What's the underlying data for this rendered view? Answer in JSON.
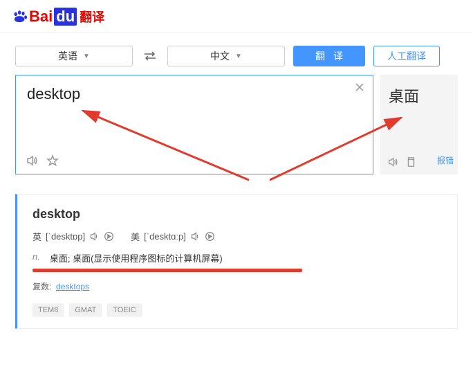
{
  "brand": {
    "bai": "Bai",
    "du": "du",
    "service": "翻译"
  },
  "langs": {
    "source": "英语",
    "target": "中文"
  },
  "buttons": {
    "translate": "翻译",
    "human": "人工翻译"
  },
  "source": {
    "text": "desktop"
  },
  "target": {
    "text": "桌面",
    "report": "报错"
  },
  "dict": {
    "word": "desktop",
    "uk_label": "英",
    "uk_ipa": "[ˈdesktɒp]",
    "us_label": "美",
    "us_ipa": "[ˈdesktɑːp]",
    "pos": "n.",
    "definition": "桌面;  桌面(显示使用程序图标的计算机屏幕)",
    "plural_label": "复数:",
    "plural_value": "desktops",
    "tags": [
      "TEM8",
      "GMAT",
      "TOEIC"
    ]
  }
}
